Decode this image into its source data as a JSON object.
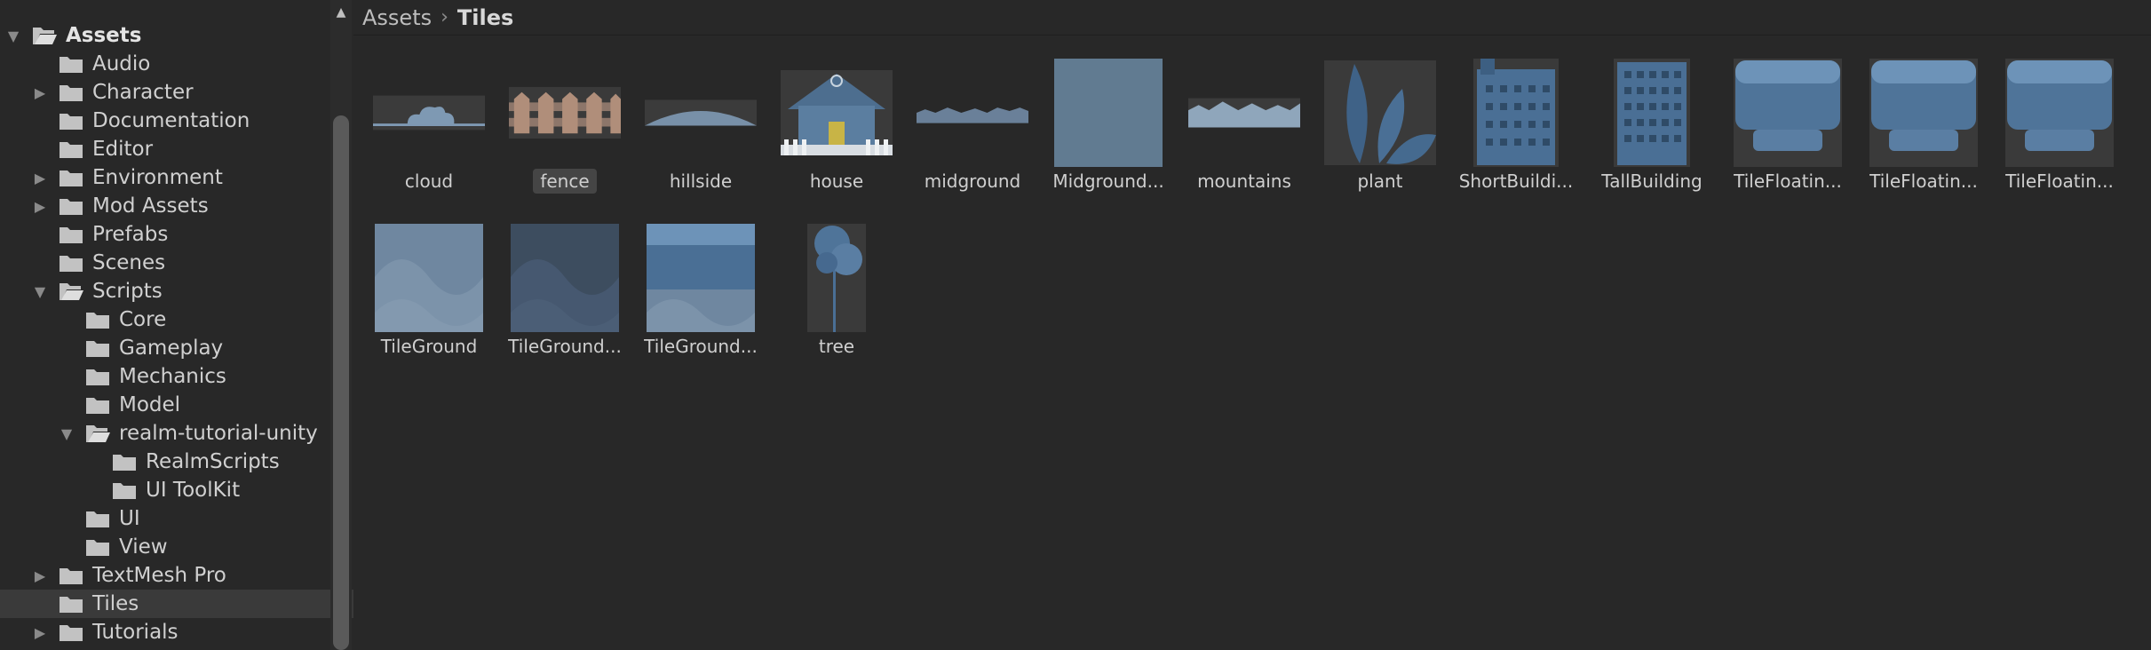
{
  "tree": {
    "items": [
      {
        "label": "Assets",
        "depth": 0,
        "expanded": true,
        "has_children": true,
        "selected": false
      },
      {
        "label": "Audio",
        "depth": 1,
        "expanded": false,
        "has_children": false,
        "selected": false
      },
      {
        "label": "Character",
        "depth": 1,
        "expanded": false,
        "has_children": true,
        "selected": false
      },
      {
        "label": "Documentation",
        "depth": 1,
        "expanded": false,
        "has_children": false,
        "selected": false
      },
      {
        "label": "Editor",
        "depth": 1,
        "expanded": false,
        "has_children": false,
        "selected": false
      },
      {
        "label": "Environment",
        "depth": 1,
        "expanded": false,
        "has_children": true,
        "selected": false
      },
      {
        "label": "Mod Assets",
        "depth": 1,
        "expanded": false,
        "has_children": true,
        "selected": false
      },
      {
        "label": "Prefabs",
        "depth": 1,
        "expanded": false,
        "has_children": false,
        "selected": false
      },
      {
        "label": "Scenes",
        "depth": 1,
        "expanded": false,
        "has_children": false,
        "selected": false
      },
      {
        "label": "Scripts",
        "depth": 1,
        "expanded": true,
        "has_children": true,
        "selected": false
      },
      {
        "label": "Core",
        "depth": 2,
        "expanded": false,
        "has_children": false,
        "selected": false
      },
      {
        "label": "Gameplay",
        "depth": 2,
        "expanded": false,
        "has_children": false,
        "selected": false
      },
      {
        "label": "Mechanics",
        "depth": 2,
        "expanded": false,
        "has_children": false,
        "selected": false
      },
      {
        "label": "Model",
        "depth": 2,
        "expanded": false,
        "has_children": false,
        "selected": false
      },
      {
        "label": "realm-tutorial-unity",
        "depth": 2,
        "expanded": true,
        "has_children": true,
        "selected": false
      },
      {
        "label": "RealmScripts",
        "depth": 3,
        "expanded": false,
        "has_children": false,
        "selected": false
      },
      {
        "label": "UI ToolKit",
        "depth": 3,
        "expanded": false,
        "has_children": false,
        "selected": false
      },
      {
        "label": "UI",
        "depth": 2,
        "expanded": false,
        "has_children": false,
        "selected": false
      },
      {
        "label": "View",
        "depth": 2,
        "expanded": false,
        "has_children": false,
        "selected": false
      },
      {
        "label": "TextMesh Pro",
        "depth": 1,
        "expanded": false,
        "has_children": true,
        "selected": false
      },
      {
        "label": "Tiles",
        "depth": 1,
        "expanded": false,
        "has_children": false,
        "selected": true
      },
      {
        "label": "Tutorials",
        "depth": 1,
        "expanded": false,
        "has_children": true,
        "selected": false
      }
    ]
  },
  "breadcrumb": {
    "root": "Assets",
    "separator": "›",
    "current": "Tiles"
  },
  "assets": [
    {
      "label": "cloud",
      "icon": "cloud-sprite-icon",
      "selected": false
    },
    {
      "label": "fence",
      "icon": "fence-sprite-icon",
      "selected": true
    },
    {
      "label": "hillside",
      "icon": "hillside-sprite-icon",
      "selected": false
    },
    {
      "label": "house",
      "icon": "house-sprite-icon",
      "selected": false
    },
    {
      "label": "midground",
      "icon": "midground-sprite-icon",
      "selected": false
    },
    {
      "label": "Midground...",
      "icon": "midground-square-sprite-icon",
      "selected": false
    },
    {
      "label": "mountains",
      "icon": "mountains-sprite-icon",
      "selected": false
    },
    {
      "label": "plant",
      "icon": "plant-sprite-icon",
      "selected": false
    },
    {
      "label": "ShortBuildi...",
      "icon": "short-building-sprite-icon",
      "selected": false
    },
    {
      "label": "TallBuilding",
      "icon": "tall-building-sprite-icon",
      "selected": false
    },
    {
      "label": "TileFloatin...",
      "icon": "tile-floating-sprite-icon",
      "selected": false
    },
    {
      "label": "TileFloatin...",
      "icon": "tile-floating-sprite-icon",
      "selected": false
    },
    {
      "label": "TileFloatin...",
      "icon": "tile-floating-sprite-icon",
      "selected": false
    },
    {
      "label": "TileGround",
      "icon": "tile-ground-sprite-icon",
      "selected": false
    },
    {
      "label": "TileGround...",
      "icon": "tile-ground-dark-sprite-icon",
      "selected": false
    },
    {
      "label": "TileGround...",
      "icon": "tile-ground-top-sprite-icon",
      "selected": false
    },
    {
      "label": "tree",
      "icon": "tree-sprite-icon",
      "selected": false
    }
  ]
}
